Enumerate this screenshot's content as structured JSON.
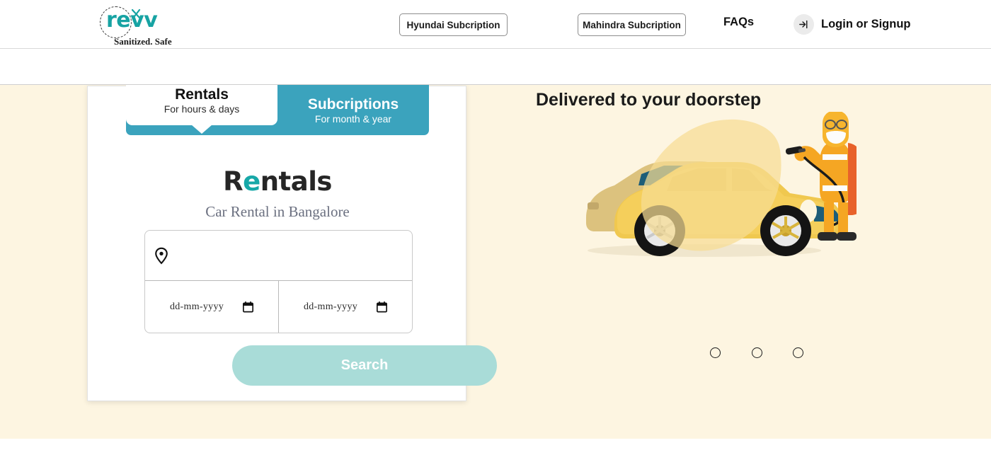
{
  "nav": {
    "brand_word": "revv",
    "brand_tagline": "Sanitized. Safe",
    "hyundai_label": "Hyundai Subcription",
    "mahindra_label": "Mahindra Subcription",
    "faqs_label": "FAQs",
    "login_label": "Login or Signup",
    "login_icon": "login-arrow-icon",
    "brand_icon": "revv-logo-icon"
  },
  "search_bar": {
    "location_icon": "map-pin-icon",
    "location_value": "",
    "location_placeholder": "",
    "start_date_placeholder": "dd-mm-yyyy",
    "start_date_value": "",
    "end_date_placeholder": "dd-mm-yyyy",
    "end_date_value": "",
    "calendar_icon": "calendar-icon",
    "search_label": "Search",
    "search_color": "#8cc0d8"
  },
  "hero": {
    "background_color": "#fdf5e1",
    "headline": "Delivered to your doorstep",
    "illustration": "car-sanitization-illustration",
    "carousel_dots": 3,
    "active_dot_index": -1
  },
  "card": {
    "tabs": [
      {
        "title": "Rentals",
        "subtitle": "For hours & days",
        "active": true
      },
      {
        "title": "Subcriptions",
        "subtitle": "For month & year",
        "active": false
      }
    ],
    "tab_color": "#3ba3bd",
    "logo_part1": "R",
    "logo_accent": "e",
    "logo_part2": "ntals",
    "subtitle": "Car Rental in Bangalore",
    "location_icon": "map-pin-icon",
    "location_value": "",
    "location_placeholder": "",
    "start_date_placeholder": "dd-mm-yyyy",
    "end_date_placeholder": "dd-mm-yyyy",
    "calendar_icon": "calendar-icon",
    "search_label": "Search",
    "search_color": "#a9dcd8"
  }
}
